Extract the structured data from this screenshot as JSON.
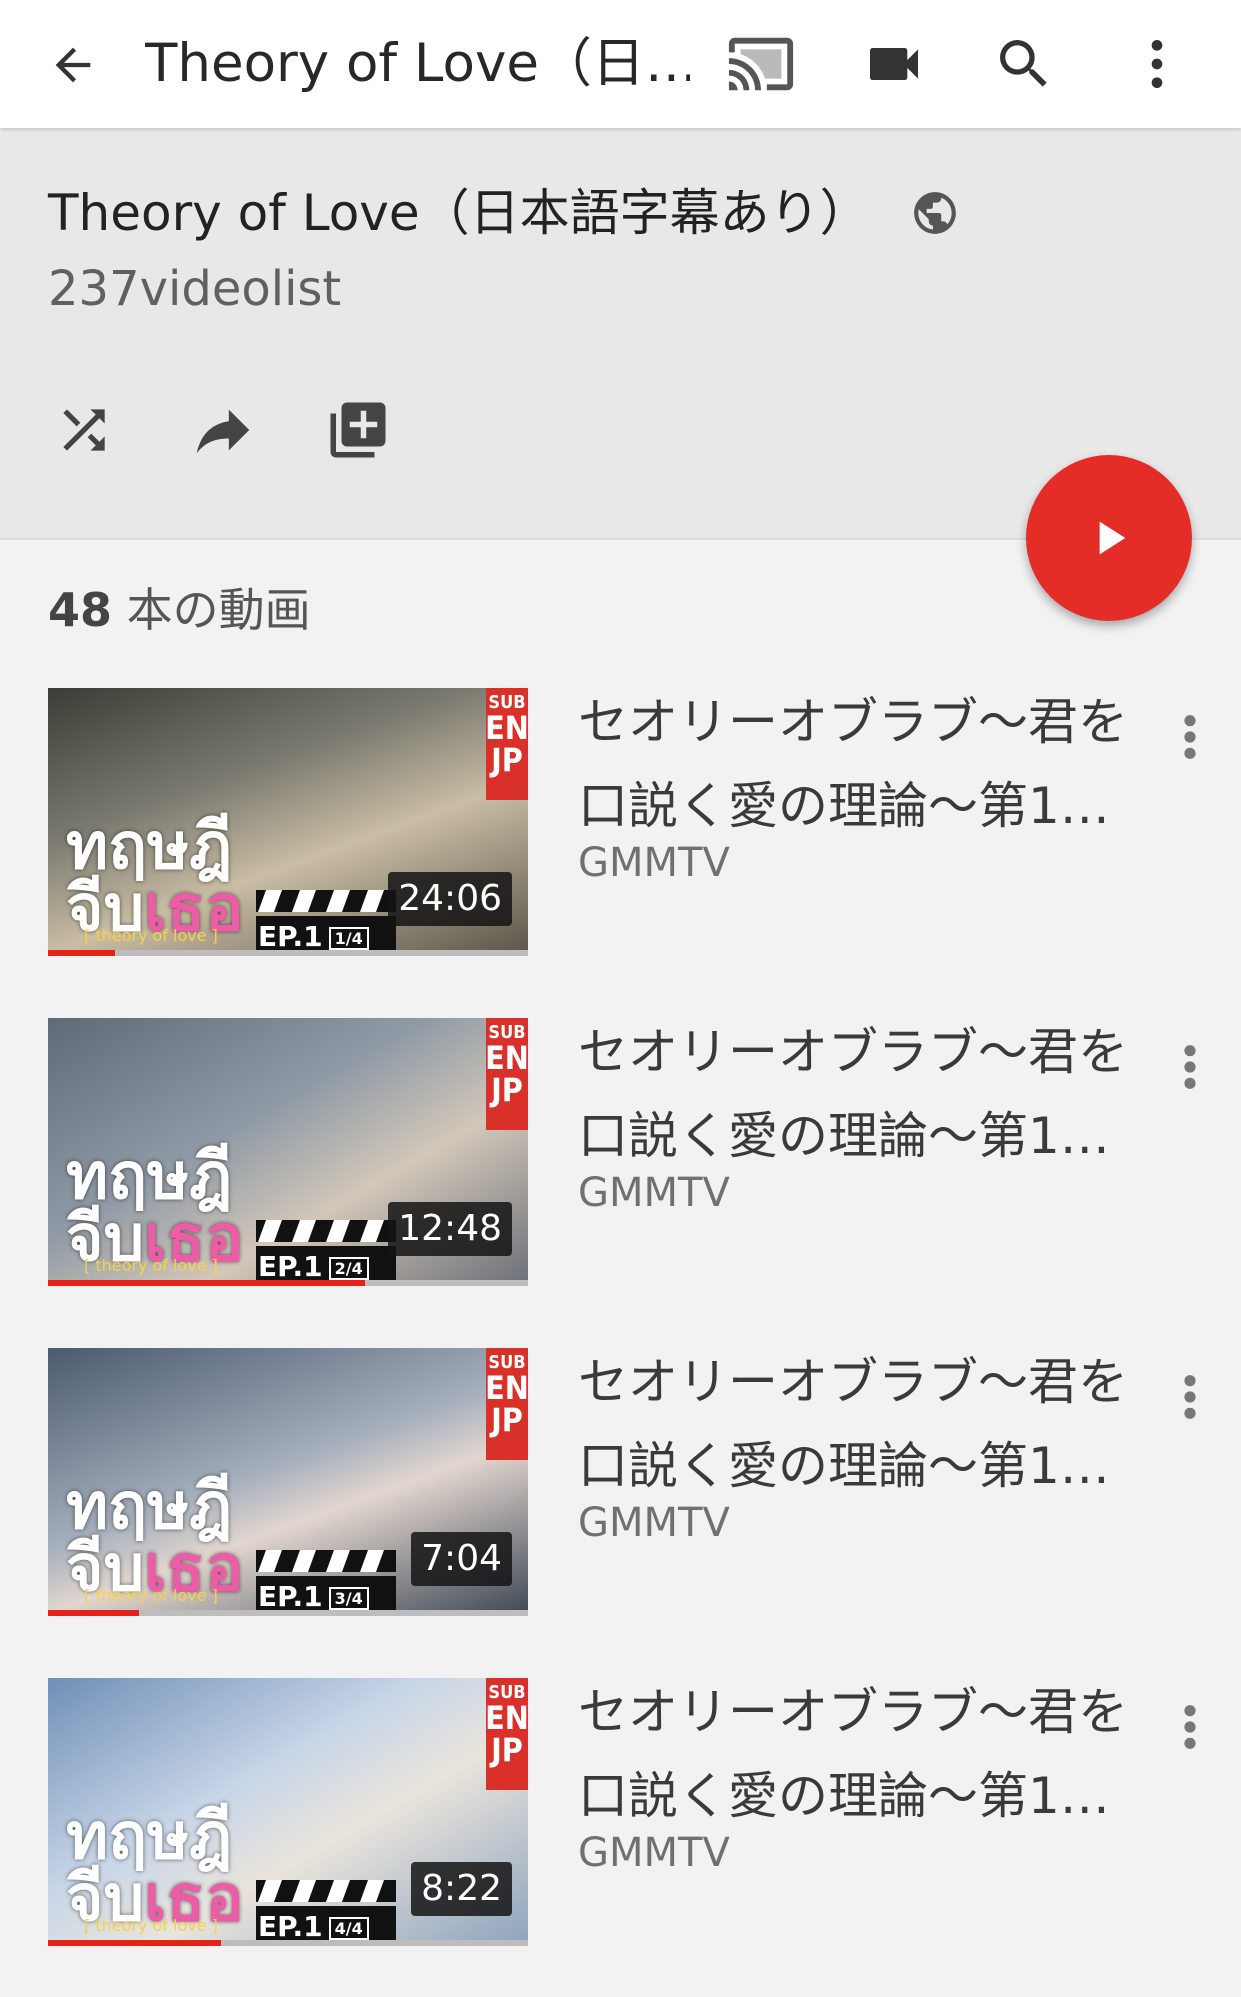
{
  "appbar": {
    "title": "Theory of Love（日…",
    "icons": [
      "back-arrow-icon",
      "cast-icon",
      "video-camera-icon",
      "search-icon",
      "more-vert-icon"
    ]
  },
  "playlist": {
    "title": "Theory of Love（日本語字幕あり）",
    "author": "237videolist",
    "visibility_icon": "globe-icon",
    "actions": [
      "shuffle-icon",
      "share-icon",
      "add-to-playlist-icon"
    ],
    "count_number": "48",
    "count_suffix": " 本の動画"
  },
  "colors": {
    "accent": "#e52d27",
    "header_bg": "#e8e8e8",
    "page_bg": "#f2f2f2"
  },
  "videos": [
    {
      "title_line1": "セオリーオブラブ〜君を",
      "title_line2": "口説く愛の理論〜第1…",
      "channel": "GMMTV",
      "duration": "24:06",
      "episode": "EP.1",
      "part": "1/4",
      "watched_fraction": 0.14,
      "badge": [
        "SUB",
        "EN",
        "JP"
      ],
      "logo_top": "ทฤษฎี",
      "logo_bottom_white": "จีบ",
      "logo_bottom_pink": "เธอ",
      "logo_tag": "[ theory of love ]"
    },
    {
      "title_line1": "セオリーオブラブ〜君を",
      "title_line2": "口説く愛の理論〜第1…",
      "channel": "GMMTV",
      "duration": "12:48",
      "episode": "EP.1",
      "part": "2/4",
      "watched_fraction": 0.66,
      "badge": [
        "SUB",
        "EN",
        "JP"
      ],
      "logo_top": "ทฤษฎี",
      "logo_bottom_white": "จีบ",
      "logo_bottom_pink": "เธอ",
      "logo_tag": "[ theory of love ]"
    },
    {
      "title_line1": "セオリーオブラブ〜君を",
      "title_line2": "口説く愛の理論〜第1…",
      "channel": "GMMTV",
      "duration": "7:04",
      "episode": "EP.1",
      "part": "3/4",
      "watched_fraction": 0.19,
      "badge": [
        "SUB",
        "EN",
        "JP"
      ],
      "logo_top": "ทฤษฎี",
      "logo_bottom_white": "จีบ",
      "logo_bottom_pink": "เธอ",
      "logo_tag": "[ theory of love ]"
    },
    {
      "title_line1": "セオリーオブラブ〜君を",
      "title_line2": "口説く愛の理論〜第1…",
      "channel": "GMMTV",
      "duration": "8:22",
      "episode": "EP.1",
      "part": "4/4",
      "watched_fraction": 0.36,
      "badge": [
        "SUB",
        "EN",
        "JP"
      ],
      "logo_top": "ทฤษฎี",
      "logo_bottom_white": "จีบ",
      "logo_bottom_pink": "เธอ",
      "logo_tag": "[ theory of love ]"
    }
  ]
}
